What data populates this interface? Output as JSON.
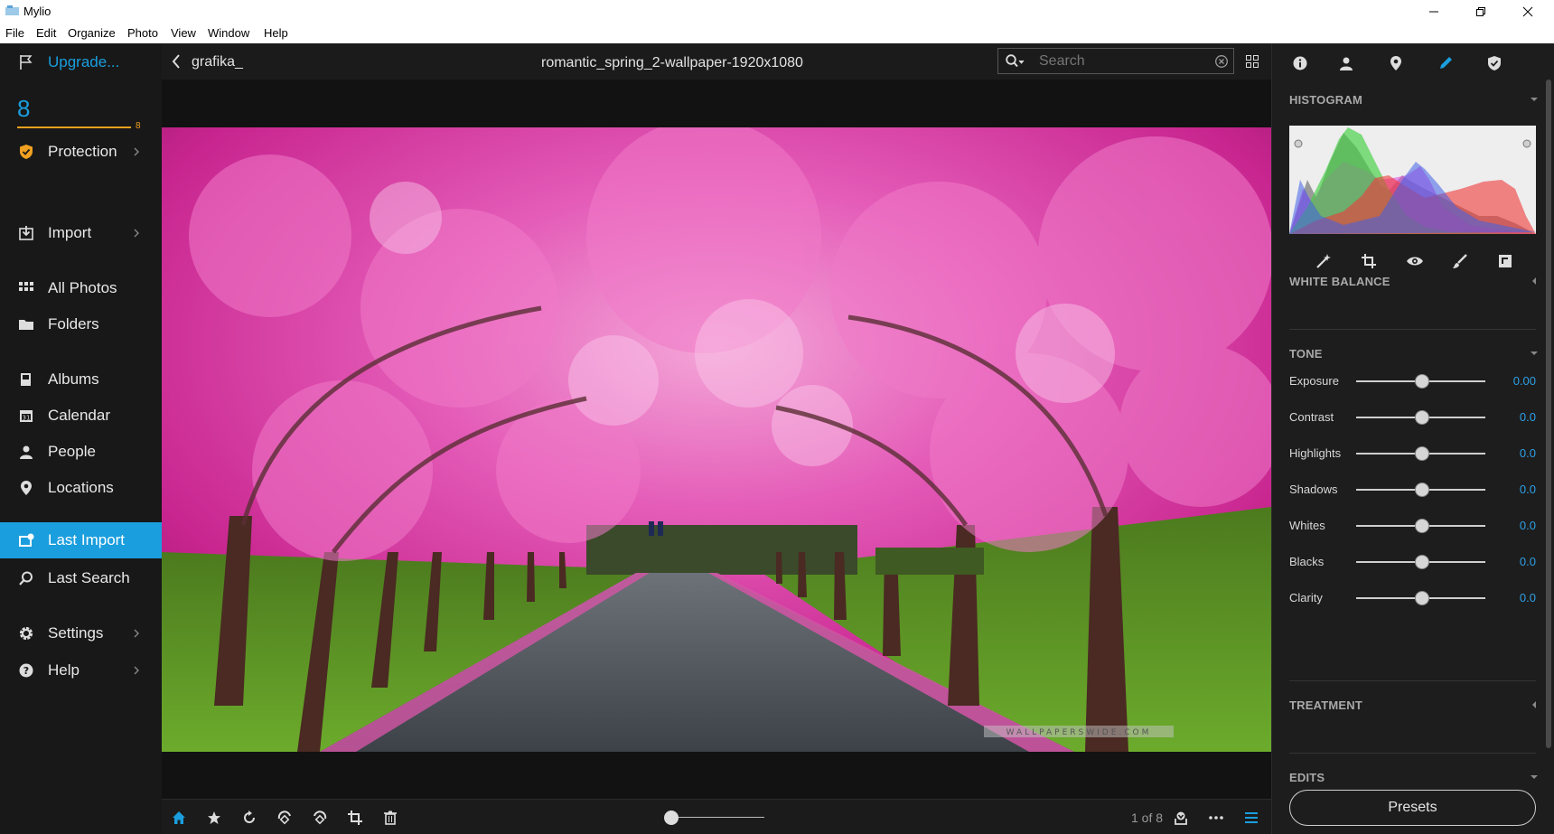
{
  "window": {
    "title": "Mylio"
  },
  "menu": [
    "File",
    "Edit",
    "Organize",
    "Photo",
    "View",
    "Window",
    "Help"
  ],
  "sidebar": {
    "upgrade_label": "Upgrade...",
    "count": "8",
    "count_small": "8",
    "items": [
      {
        "label": "Protection",
        "icon": "shield-icon",
        "chevron": true
      },
      {
        "label": "Import",
        "icon": "import-icon",
        "chevron": true
      },
      {
        "label": "All Photos",
        "icon": "grid-icon",
        "chevron": false
      },
      {
        "label": "Folders",
        "icon": "folder-icon",
        "chevron": false
      },
      {
        "label": "Albums",
        "icon": "album-icon",
        "chevron": false
      },
      {
        "label": "Calendar",
        "icon": "calendar-icon",
        "chevron": false
      },
      {
        "label": "People",
        "icon": "person-icon",
        "chevron": false
      },
      {
        "label": "Locations",
        "icon": "pin-icon",
        "chevron": false
      },
      {
        "label": "Last Import",
        "icon": "last-import-icon",
        "chevron": false,
        "active": true
      },
      {
        "label": "Last Search",
        "icon": "search-icon",
        "chevron": false
      },
      {
        "label": "Settings",
        "icon": "gear-icon",
        "chevron": true
      },
      {
        "label": "Help",
        "icon": "help-icon",
        "chevron": true
      }
    ]
  },
  "topbar": {
    "back_label": "grafika_",
    "photo_title": "romantic_spring_2-wallpaper-1920x1080",
    "search_placeholder": "Search"
  },
  "photo": {
    "watermark": "WALLPAPERSWIDE.COM"
  },
  "bottombar": {
    "counter": "1 of 8",
    "zoom": 0.05
  },
  "right_panel": {
    "histogram_title": "HISTOGRAM",
    "white_balance_title": "WHITE BALANCE",
    "tone_title": "TONE",
    "tone_sliders": [
      {
        "label": "Exposure",
        "value": "0.00"
      },
      {
        "label": "Contrast",
        "value": "0.0"
      },
      {
        "label": "Highlights",
        "value": "0.0"
      },
      {
        "label": "Shadows",
        "value": "0.0"
      },
      {
        "label": "Whites",
        "value": "0.0"
      },
      {
        "label": "Blacks",
        "value": "0.0"
      },
      {
        "label": "Clarity",
        "value": "0.0"
      }
    ],
    "treatment_title": "TREATMENT",
    "edits_title": "EDITS",
    "presets_label": "Presets"
  },
  "colors": {
    "accent": "#1a9ede",
    "value_blue": "#2ea0e6",
    "protection_orange": "#f0a020"
  }
}
